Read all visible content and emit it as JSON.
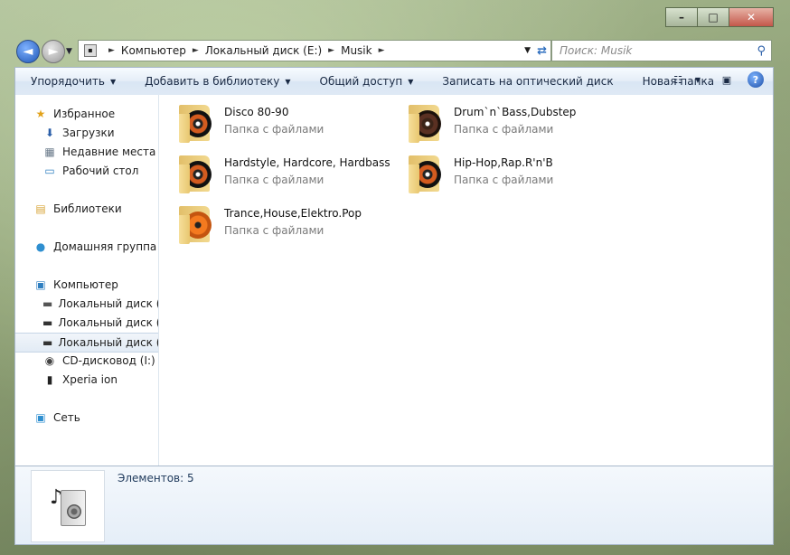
{
  "window_controls": {
    "minimize": "–",
    "maximize": "□",
    "close": "✕"
  },
  "address": {
    "crumbs": [
      "Компьютер",
      "Локальный диск (E:)",
      "Musik"
    ]
  },
  "search": {
    "placeholder": "Поиск: Musik"
  },
  "toolbar": {
    "organize": "Упорядочить",
    "add_library": "Добавить в библиотеку",
    "share": "Общий доступ",
    "burn": "Записать на оптический диск",
    "new_folder": "Новая папка"
  },
  "sidebar": {
    "favorites": "Избранное",
    "downloads": "Загрузки",
    "recent": "Недавние места",
    "desktop": "Рабочий стол",
    "libraries": "Библиотеки",
    "homegroup": "Домашняя группа",
    "computer": "Компьютер",
    "disk_c": "Локальный диск (C",
    "disk_d": "Локальный диск (D",
    "disk_e": "Локальный диск (E:",
    "cd": "CD-дисковод (I:)",
    "xperia": "Xperia ion",
    "network": "Сеть"
  },
  "files": [
    {
      "name": "Disco 80-90",
      "type": "Папка с файлами"
    },
    {
      "name": "Drum`n`Bass,Dubstep",
      "type": "Папка с файлами"
    },
    {
      "name": "Hardstyle, Hardcore, Hardbass",
      "type": "Папка с файлами"
    },
    {
      "name": "Hip-Hop,Rap.R'n'B",
      "type": "Папка с файлами"
    },
    {
      "name": "Trance,House,Elektro.Pop",
      "type": "Папка с файлами"
    }
  ],
  "details": {
    "count": "Элементов: 5"
  }
}
